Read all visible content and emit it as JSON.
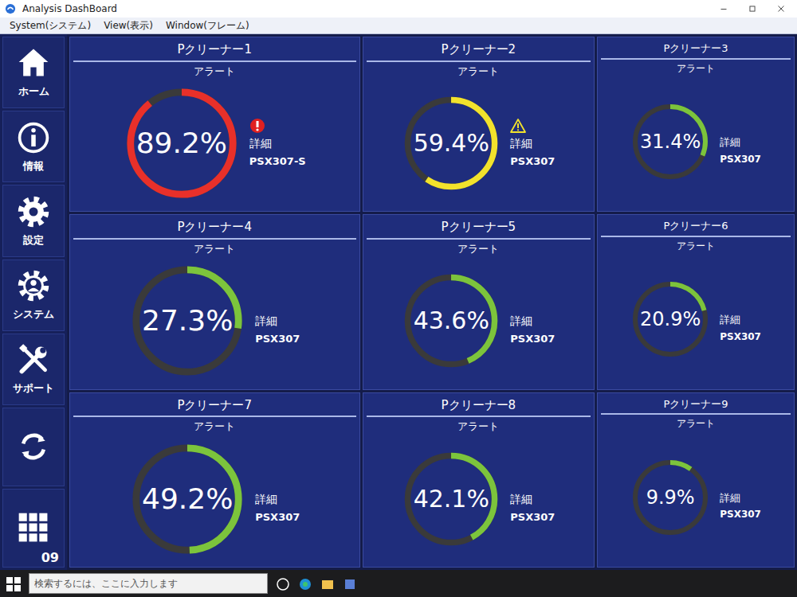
{
  "window": {
    "title": "Analysis DashBoard"
  },
  "menu": [
    {
      "label": "System(システム)"
    },
    {
      "label": "View(表示)"
    },
    {
      "label": "Window(フレーム)"
    }
  ],
  "sidebar": {
    "items": [
      {
        "label": "ホーム"
      },
      {
        "label": "情報"
      },
      {
        "label": "設定"
      },
      {
        "label": "システム"
      },
      {
        "label": "サポート"
      }
    ],
    "grid_button": {
      "label": "09"
    }
  },
  "cleaners": [
    {
      "title": "Pクリーナー1",
      "label": "アラート",
      "value": "89.2%",
      "level": 0.892,
      "color": "#e8302a",
      "kind": "error",
      "detail": "詳細",
      "model": "PSX307-S"
    },
    {
      "title": "Pクリーナー2",
      "label": "アラート",
      "value": "59.4%",
      "level": 0.594,
      "color": "#f2e22c",
      "kind": "warning",
      "detail": "詳細",
      "model": "PSX307"
    },
    {
      "title": "Pクリーナー3",
      "label": "アラート",
      "value": "31.4%",
      "level": 0.314,
      "color": "#7cc43c",
      "kind": "normal",
      "detail": "詳細",
      "model": "PSX307"
    },
    {
      "title": "Pクリーナー4",
      "label": "アラート",
      "value": "27.3%",
      "level": 0.273,
      "color": "#7cc43c",
      "kind": "normal",
      "detail": "詳細",
      "model": "PSX307"
    },
    {
      "title": "Pクリーナー5",
      "label": "アラート",
      "value": "43.6%",
      "level": 0.436,
      "color": "#7cc43c",
      "kind": "normal",
      "detail": "詳細",
      "model": "PSX307"
    },
    {
      "title": "Pクリーナー6",
      "label": "アラート",
      "value": "20.9%",
      "level": 0.209,
      "color": "#7cc43c",
      "kind": "normal",
      "detail": "詳細",
      "model": "PSX307"
    },
    {
      "title": "Pクリーナー7",
      "label": "アラート",
      "value": "49.2%",
      "level": 0.492,
      "color": "#7cc43c",
      "kind": "normal",
      "detail": "詳細",
      "model": "PSX307"
    },
    {
      "title": "Pクリーナー8",
      "label": "アラート",
      "value": "42.1%",
      "level": 0.421,
      "color": "#7cc43c",
      "kind": "normal",
      "detail": "詳細",
      "model": "PSX307"
    },
    {
      "title": "Pクリーナー9",
      "label": "アラート",
      "value": "9.9%",
      "level": 0.099,
      "color": "#7cc43c",
      "kind": "normal",
      "detail": "詳細",
      "model": "PSX307"
    }
  ],
  "taskbar": {
    "search": {
      "placeholder": "検索するには、ここに入力します"
    }
  }
}
